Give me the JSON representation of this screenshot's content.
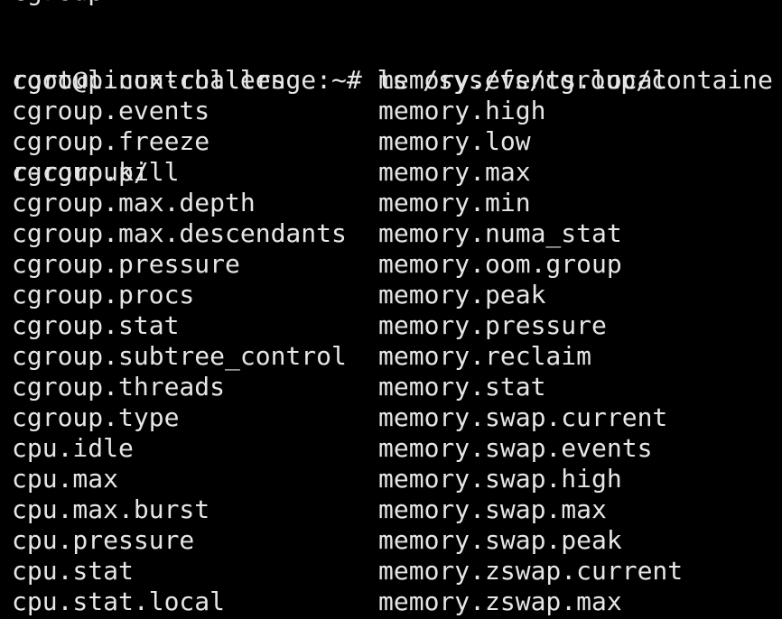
{
  "terminal": {
    "cut_top_text": "cgroup.",
    "prompt_line_1": "root@linux-challenge:~# ls /sys/fs/cgroup/containe",
    "prompt_line_2": "r-cgroup/",
    "left_column": [
      "cgroup.controllers",
      "cgroup.events",
      "cgroup.freeze",
      "cgroup.kill",
      "cgroup.max.depth",
      "cgroup.max.descendants",
      "cgroup.pressure",
      "cgroup.procs",
      "cgroup.stat",
      "cgroup.subtree_control",
      "cgroup.threads",
      "cgroup.type",
      "cpu.idle",
      "cpu.max",
      "cpu.max.burst",
      "cpu.pressure",
      "cpu.stat",
      "cpu.stat.local"
    ],
    "right_column": [
      "memory.events.local",
      "memory.high",
      "memory.low",
      "memory.max",
      "memory.min",
      "memory.numa_stat",
      "memory.oom.group",
      "memory.peak",
      "memory.pressure",
      "memory.reclaim",
      "memory.stat",
      "memory.swap.current",
      "memory.swap.events",
      "memory.swap.high",
      "memory.swap.max",
      "memory.swap.peak",
      "memory.zswap.current",
      "memory.zswap.max"
    ],
    "colors": {
      "background": "#000000",
      "foreground": "#e6e6e6"
    }
  }
}
